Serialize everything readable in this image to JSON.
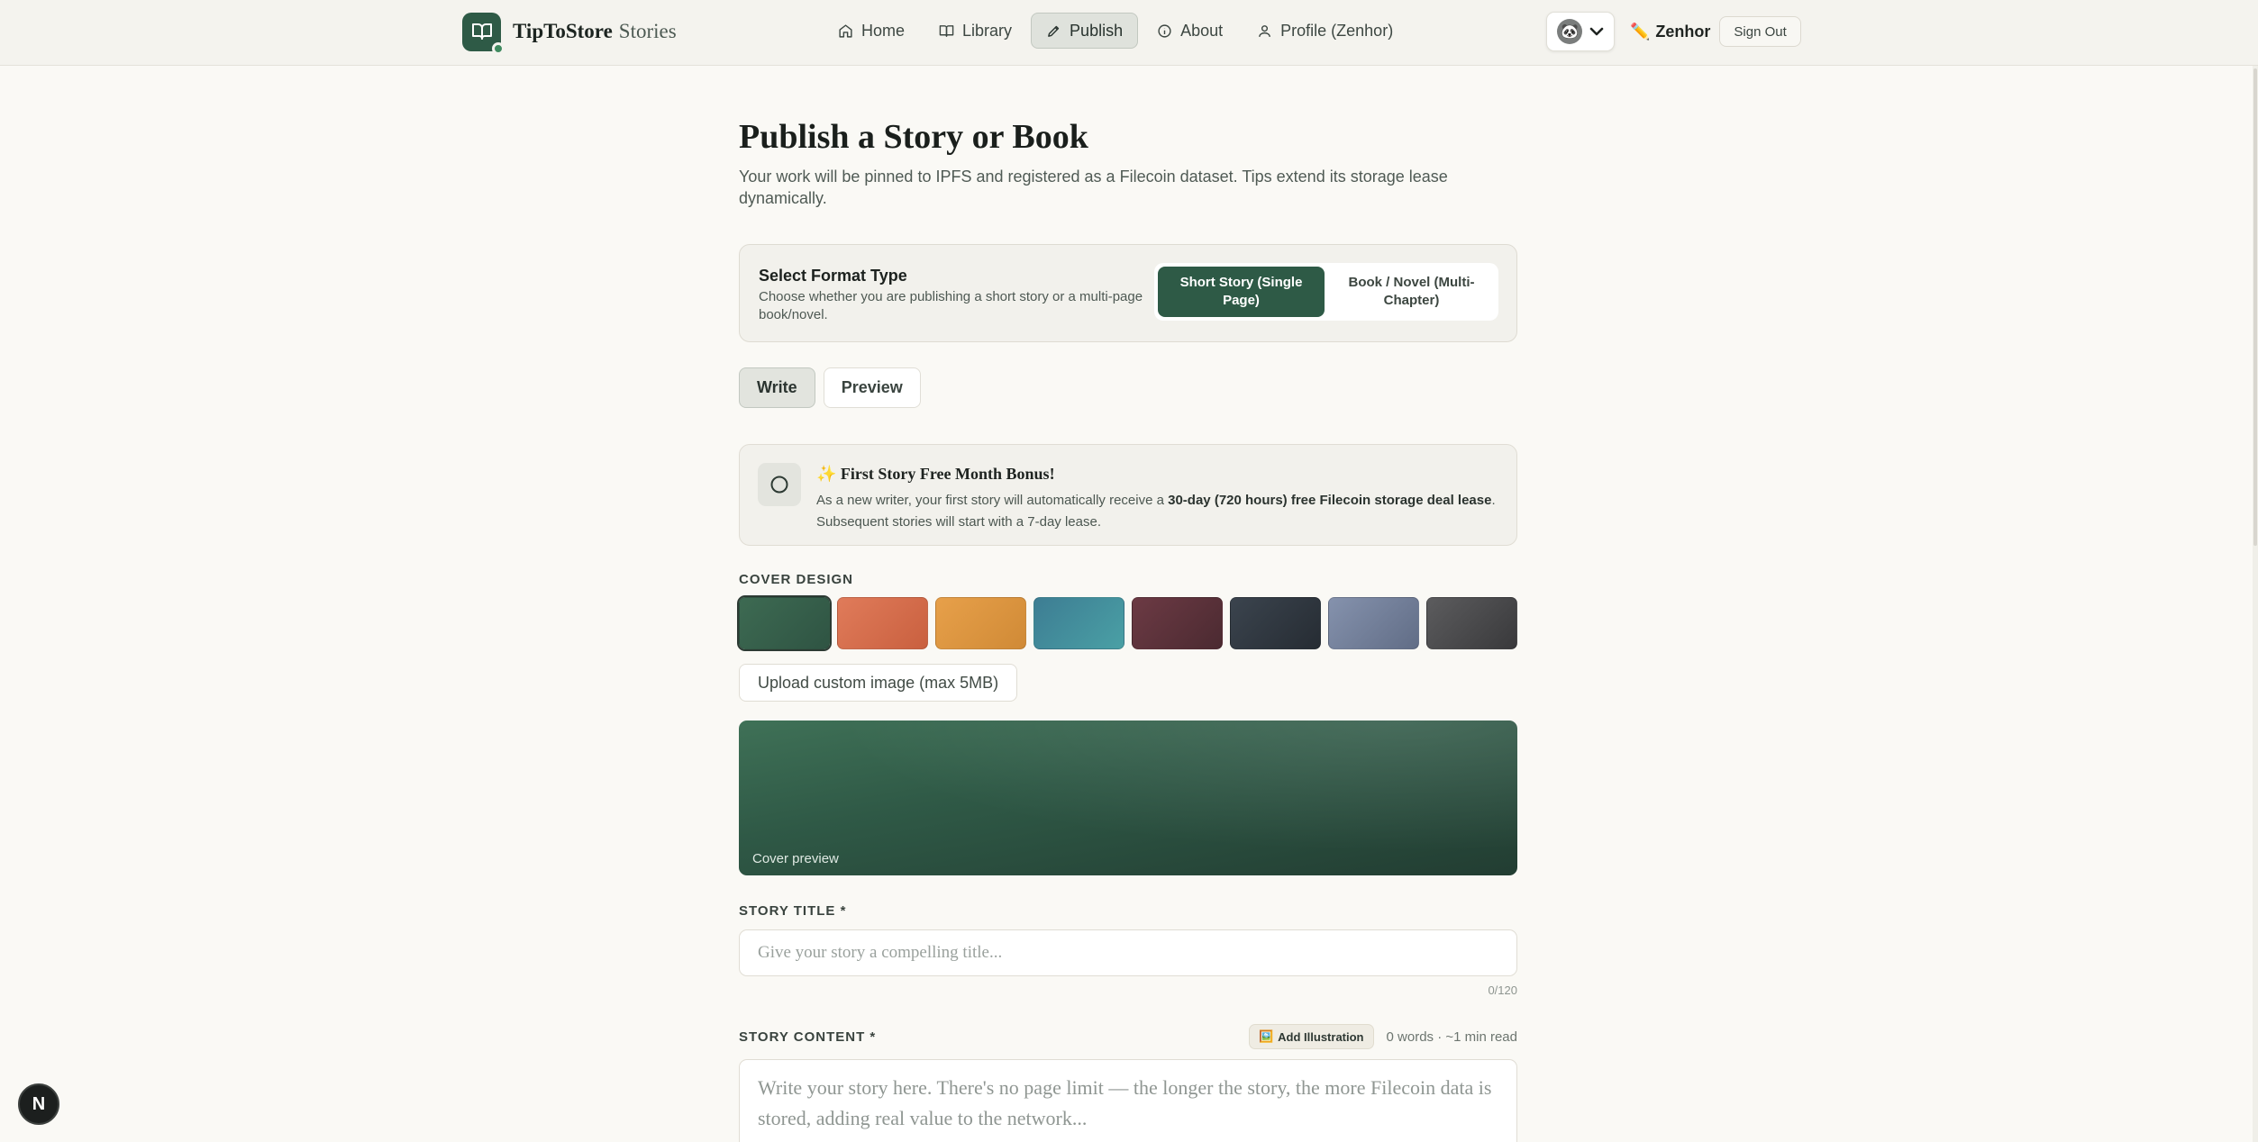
{
  "brand": {
    "name": "TipToStore",
    "suffix": "Stories"
  },
  "nav": {
    "items": [
      {
        "label": "Home",
        "icon": "home-icon"
      },
      {
        "label": "Library",
        "icon": "book-icon"
      },
      {
        "label": "Publish",
        "icon": "pencil-icon",
        "active": true
      },
      {
        "label": "About",
        "icon": "info-icon"
      },
      {
        "label": "Profile (Zenhor)",
        "icon": "user-icon"
      }
    ]
  },
  "account": {
    "avatar_glyph": "🐼",
    "username": "Zenhor",
    "username_icon": "✏️",
    "signout_label": "Sign Out"
  },
  "page": {
    "title": "Publish a Story or Book",
    "description": "Your work will be pinned to IPFS and registered as a Filecoin dataset. Tips extend its storage lease dynamically."
  },
  "format": {
    "title": "Select Format Type",
    "description": "Choose whether you are publishing a short story or a multi-page book/novel.",
    "options": [
      {
        "label": "Short Story (Single Page)",
        "active": true
      },
      {
        "label": "Book / Novel (Multi-Chapter)",
        "active": false
      }
    ]
  },
  "tabs": [
    {
      "label": "Write",
      "active": true
    },
    {
      "label": "Preview",
      "active": false
    }
  ],
  "bonus": {
    "title": "✨ First Story Free Month Bonus!",
    "text_pre": "As a new writer, your first story will automatically receive a ",
    "text_bold": "30-day (720 hours) free Filecoin storage deal lease",
    "text_post": ". Subsequent stories will start with a 7-day lease."
  },
  "cover": {
    "label": "COVER DESIGN",
    "swatches": [
      {
        "from": "#3d6a52",
        "to": "#2f5443",
        "selected": true
      },
      {
        "from": "#e07b5a",
        "to": "#c9603f"
      },
      {
        "from": "#e7a04a",
        "to": "#d08a36"
      },
      {
        "from": "#3d7d93",
        "to": "#4aa0a5"
      },
      {
        "from": "#6c3a44",
        "to": "#4b2a31"
      },
      {
        "from": "#3b444e",
        "to": "#262c33"
      },
      {
        "from": "#8592ad",
        "to": "#616d86"
      },
      {
        "from": "#5c5c5e",
        "to": "#39393b"
      }
    ],
    "upload_label": "Upload custom image (max 5MB)",
    "preview_caption": "Cover preview"
  },
  "story_title": {
    "label": "STORY TITLE *",
    "placeholder": "Give your story a compelling title...",
    "value": "",
    "counter": "0/120"
  },
  "story_content": {
    "label": "STORY CONTENT *",
    "illustration_label": "Add Illustration",
    "illustration_icon": "🖼️",
    "word_count": "0 words · ~1 min read",
    "placeholder": "Write your story here. There's no page limit — the longer the story, the more Filecoin data is stored, adding real value to the network..."
  },
  "floating_badge": {
    "label": "N"
  },
  "colors": {
    "accent": "#2e5a46",
    "background": "#faf9f5",
    "nav_bg": "#f4f3ee"
  }
}
